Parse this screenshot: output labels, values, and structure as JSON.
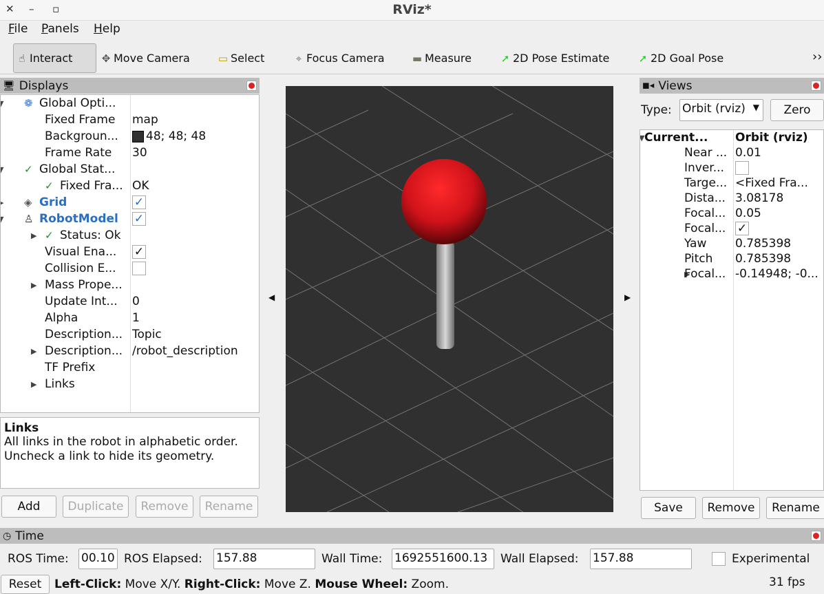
{
  "window": {
    "title": "RViz*",
    "close": "✕",
    "minimize": "–",
    "maximize": "▫"
  },
  "menu": [
    {
      "label": "File",
      "key": "F",
      "rest": "ile"
    },
    {
      "label": "Panels",
      "key": "P",
      "rest": "anels"
    },
    {
      "label": "Help",
      "key": "H",
      "rest": "elp"
    }
  ],
  "toolbar": [
    {
      "label": "Interact",
      "icon": "hand-pointer-icon",
      "glyph": "☝",
      "active": true
    },
    {
      "label": "Move Camera",
      "icon": "move-camera-icon",
      "glyph": "✥"
    },
    {
      "label": "Select",
      "icon": "select-icon",
      "glyph": "▭"
    },
    {
      "label": "Focus Camera",
      "icon": "focus-camera-icon",
      "glyph": "⌖"
    },
    {
      "label": "Measure",
      "icon": "ruler-icon",
      "glyph": "▬"
    },
    {
      "label": "2D Pose Estimate",
      "icon": "pose-estimate-arrow-icon",
      "glyph": "➚"
    },
    {
      "label": "2D Goal Pose",
      "icon": "goal-pose-arrow-icon",
      "glyph": "➚"
    }
  ],
  "toolbar_overflow": "››",
  "displays": {
    "title": "Displays",
    "rows": [
      {
        "name": "Global Opti...",
        "value": "",
        "arrow": "down",
        "indent": 0,
        "icon": "gear"
      },
      {
        "name": "Fixed Frame",
        "value": "map",
        "indent": 1
      },
      {
        "name": "Backgroun...",
        "value": "48; 48; 48",
        "indent": 1,
        "swatch": "#303030"
      },
      {
        "name": "Frame Rate",
        "value": "30",
        "indent": 1
      },
      {
        "name": "Global Stat...",
        "value": "",
        "arrow": "down",
        "indent": 0,
        "icon": "check"
      },
      {
        "name": "Fixed Fra...",
        "value": "OK",
        "indent": 1,
        "icon": "check"
      },
      {
        "name": "Grid",
        "value": "",
        "arrow": "right",
        "indent": 0,
        "icon": "grid",
        "bold": true,
        "checkbox": true
      },
      {
        "name": "RobotModel",
        "value": "",
        "arrow": "down",
        "indent": 0,
        "icon": "robot",
        "bold": true,
        "checkbox": true
      },
      {
        "name": "Status: Ok",
        "value": "",
        "arrow": "right",
        "indent": 1,
        "icon": "check"
      },
      {
        "name": "Visual Ena...",
        "value": "",
        "indent": 1,
        "checkbox": true,
        "black": true
      },
      {
        "name": "Collision E...",
        "value": "",
        "indent": 1,
        "checkbox": false
      },
      {
        "name": "Mass Prope...",
        "value": "",
        "arrow": "right",
        "indent": 1
      },
      {
        "name": "Update Int...",
        "value": "0",
        "indent": 1
      },
      {
        "name": "Alpha",
        "value": "1",
        "indent": 1
      },
      {
        "name": "Description...",
        "value": "Topic",
        "indent": 1
      },
      {
        "name": "Description...",
        "value": "/robot_description",
        "arrow": "right",
        "indent": 1
      },
      {
        "name": "TF Prefix",
        "value": "",
        "indent": 1
      },
      {
        "name": "Links",
        "value": "",
        "arrow": "right",
        "indent": 1
      }
    ],
    "help_title": "Links",
    "help_text": "All links in the robot in alphabetic order. Uncheck a link to hide its geometry.",
    "buttons": {
      "add": "Add",
      "duplicate": "Duplicate",
      "remove": "Remove",
      "rename": "Rename"
    }
  },
  "viewport": {
    "background": "#303030",
    "sphere_color": "#e8141c"
  },
  "views": {
    "title": "Views",
    "type_label": "Type:",
    "type_value": "Orbit (rviz)",
    "zero": "Zero",
    "rows": [
      {
        "name": "Current...",
        "value": "Orbit (rviz)",
        "arrow": "down",
        "bold": true,
        "indent": 0
      },
      {
        "name": "Near ...",
        "value": "0.01",
        "indent": 1
      },
      {
        "name": "Inver...",
        "value": "",
        "checkbox": false,
        "indent": 1
      },
      {
        "name": "Targe...",
        "value": "<Fixed Fra...",
        "indent": 1
      },
      {
        "name": "Dista...",
        "value": "3.08178",
        "indent": 1
      },
      {
        "name": "Focal...",
        "value": "0.05",
        "indent": 1
      },
      {
        "name": "Focal...",
        "value": "",
        "checkbox": true,
        "indent": 1
      },
      {
        "name": "Yaw",
        "value": "0.785398",
        "indent": 1
      },
      {
        "name": "Pitch",
        "value": "0.785398",
        "indent": 1
      },
      {
        "name": "Focal...",
        "value": "-0.14948; -0...",
        "arrow": "right",
        "indent": 1
      }
    ],
    "buttons": {
      "save": "Save",
      "remove": "Remove",
      "rename": "Rename"
    }
  },
  "time": {
    "title": "Time",
    "ros_time_label": "ROS Time:",
    "ros_time": "00.10",
    "ros_elapsed_label": "ROS Elapsed:",
    "ros_elapsed": "157.88",
    "wall_time_label": "Wall Time:",
    "wall_time": "1692551600.13",
    "wall_elapsed_label": "Wall Elapsed:",
    "wall_elapsed": "157.88",
    "experimental": "Experimental"
  },
  "status": {
    "reset": "Reset",
    "hint": [
      {
        "b": "Left-Click:",
        "t": " Move X/Y. "
      },
      {
        "b": "Right-Click:",
        "t": " Move Z. "
      },
      {
        "b": "Mouse Wheel:",
        "t": " Zoom."
      }
    ],
    "fps": "31 fps"
  }
}
